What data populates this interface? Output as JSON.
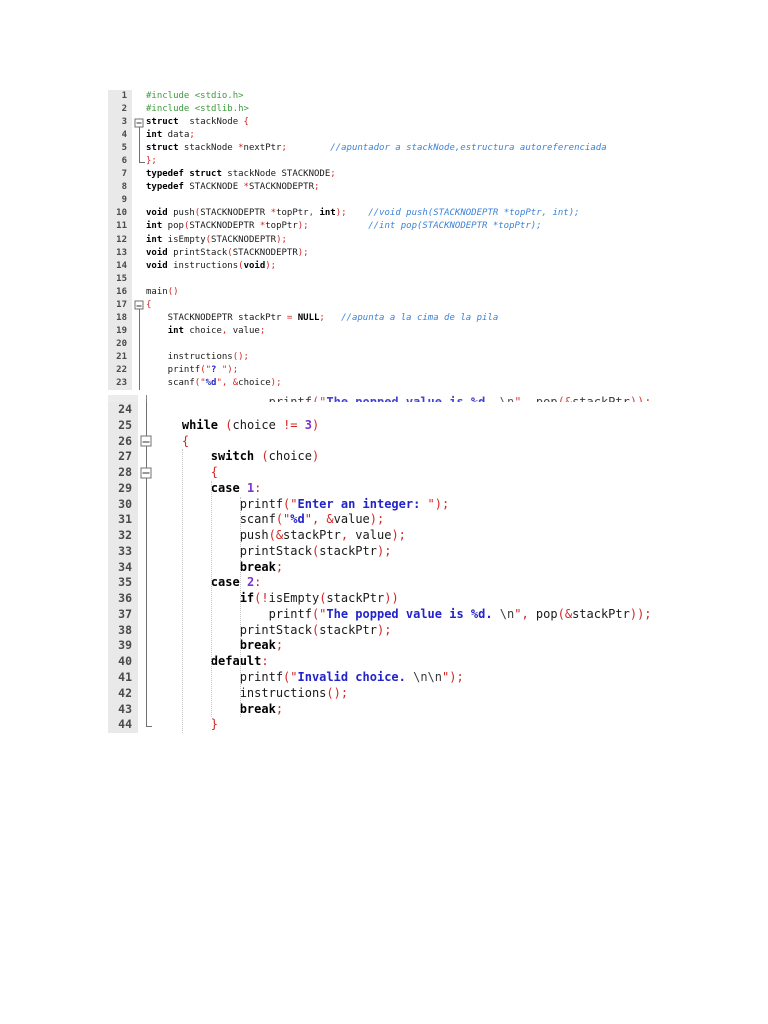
{
  "colors": {
    "gutterBg": "#e9e9e9",
    "lineNum": "#4a4a4a",
    "foldLine": "#707070",
    "punct": "#d22525",
    "preproc": "#3f9b3f",
    "comment": "#3b82d8",
    "string": "#2323cc",
    "escape": "#3a3a3a",
    "number": "#7d32cf",
    "keyword": "#000000",
    "plain": "#1a1a1a"
  },
  "blocks": [
    {
      "id": "block1",
      "lines": [
        {
          "n": 1,
          "fold": null,
          "t": [
            [
              "g",
              "#include <stdio.h>"
            ]
          ]
        },
        {
          "n": 2,
          "fold": null,
          "t": [
            [
              "g",
              "#include <stdlib.h>"
            ]
          ]
        },
        {
          "n": 3,
          "fold": "boxstart",
          "t": [
            [
              "k",
              "struct"
            ],
            [
              "n",
              "  stackNode "
            ],
            [
              "p",
              "{"
            ]
          ]
        },
        {
          "n": 4,
          "fold": "line",
          "t": [
            [
              "k",
              "int"
            ],
            [
              "n",
              " data"
            ],
            [
              "p",
              ";"
            ]
          ]
        },
        {
          "n": 5,
          "fold": "line",
          "t": [
            [
              "k",
              "struct"
            ],
            [
              "n",
              " stackNode "
            ],
            [
              "p",
              "*"
            ],
            [
              "n",
              "nextPtr"
            ],
            [
              "p",
              ";"
            ],
            [
              "n",
              "        "
            ],
            [
              "c",
              "//apuntador a stackNode,estructura autoreferenciada"
            ]
          ]
        },
        {
          "n": 6,
          "fold": "end",
          "t": [
            [
              "p",
              "};"
            ]
          ]
        },
        {
          "n": 7,
          "fold": null,
          "t": [
            [
              "k",
              "typedef"
            ],
            [
              "n",
              " "
            ],
            [
              "k",
              "struct"
            ],
            [
              "n",
              " stackNode STACKNODE"
            ],
            [
              "p",
              ";"
            ]
          ]
        },
        {
          "n": 8,
          "fold": null,
          "t": [
            [
              "k",
              "typedef"
            ],
            [
              "n",
              " STACKNODE "
            ],
            [
              "p",
              "*"
            ],
            [
              "n",
              "STACKNODEPTR"
            ],
            [
              "p",
              ";"
            ]
          ]
        },
        {
          "n": 9,
          "fold": null,
          "t": []
        },
        {
          "n": 10,
          "fold": null,
          "t": [
            [
              "k",
              "void"
            ],
            [
              "n",
              " push"
            ],
            [
              "p",
              "("
            ],
            [
              "n",
              "STACKNODEPTR "
            ],
            [
              "p",
              "*"
            ],
            [
              "n",
              "topPtr"
            ],
            [
              "p",
              ","
            ],
            [
              "n",
              " "
            ],
            [
              "k",
              "int"
            ],
            [
              "p",
              ");"
            ],
            [
              "n",
              "    "
            ],
            [
              "c",
              "//void push(STACKNODEPTR *topPtr, int);"
            ]
          ]
        },
        {
          "n": 11,
          "fold": null,
          "t": [
            [
              "k",
              "int"
            ],
            [
              "n",
              " pop"
            ],
            [
              "p",
              "("
            ],
            [
              "n",
              "STACKNODEPTR "
            ],
            [
              "p",
              "*"
            ],
            [
              "n",
              "topPtr"
            ],
            [
              "p",
              ");"
            ],
            [
              "n",
              "           "
            ],
            [
              "c",
              "//int pop(STACKNODEPTR *topPtr);"
            ]
          ]
        },
        {
          "n": 12,
          "fold": null,
          "t": [
            [
              "k",
              "int"
            ],
            [
              "n",
              " isEmpty"
            ],
            [
              "p",
              "("
            ],
            [
              "n",
              "STACKNODEPTR"
            ],
            [
              "p",
              ");"
            ]
          ]
        },
        {
          "n": 13,
          "fold": null,
          "t": [
            [
              "k",
              "void"
            ],
            [
              "n",
              " printStack"
            ],
            [
              "p",
              "("
            ],
            [
              "n",
              "STACKNODEPTR"
            ],
            [
              "p",
              ");"
            ]
          ]
        },
        {
          "n": 14,
          "fold": null,
          "t": [
            [
              "k",
              "void"
            ],
            [
              "n",
              " instructions"
            ],
            [
              "p",
              "("
            ],
            [
              "k",
              "void"
            ],
            [
              "p",
              ");"
            ]
          ]
        },
        {
          "n": 15,
          "fold": null,
          "t": []
        },
        {
          "n": 16,
          "fold": null,
          "t": [
            [
              "n",
              "main"
            ],
            [
              "p",
              "()"
            ]
          ]
        },
        {
          "n": 17,
          "fold": "boxstart",
          "t": [
            [
              "p",
              "{"
            ]
          ]
        },
        {
          "n": 18,
          "fold": "line",
          "t": [
            [
              "n",
              "    STACKNODEPTR stackPtr "
            ],
            [
              "p",
              "="
            ],
            [
              "n",
              " "
            ],
            [
              "k",
              "NULL"
            ],
            [
              "p",
              ";"
            ],
            [
              "n",
              "   "
            ],
            [
              "c",
              "//apunta a la cima de la pila"
            ]
          ]
        },
        {
          "n": 19,
          "fold": "line",
          "t": [
            [
              "n",
              "    "
            ],
            [
              "k",
              "int"
            ],
            [
              "n",
              " choice"
            ],
            [
              "p",
              ","
            ],
            [
              "n",
              " value"
            ],
            [
              "p",
              ";"
            ]
          ]
        },
        {
          "n": 20,
          "fold": "line",
          "t": []
        },
        {
          "n": 21,
          "fold": "line",
          "t": [
            [
              "n",
              "    instructions"
            ],
            [
              "p",
              "();"
            ]
          ]
        },
        {
          "n": 22,
          "fold": "line",
          "t": [
            [
              "n",
              "    printf"
            ],
            [
              "p",
              "(\""
            ],
            [
              "s",
              "? "
            ],
            [
              "p",
              "\");"
            ]
          ]
        },
        {
          "n": 23,
          "fold": "line",
          "t": [
            [
              "n",
              "    scanf"
            ],
            [
              "p",
              "(\""
            ],
            [
              "s",
              "%d"
            ],
            [
              "p",
              "\","
            ],
            [
              "n",
              " "
            ],
            [
              "p",
              "&"
            ],
            [
              "n",
              "choice"
            ],
            [
              "p",
              ");"
            ]
          ]
        }
      ]
    },
    {
      "id": "block2",
      "cut_line_top": {
        "fold": "line",
        "t": [
          [
            "n",
            "                printf"
          ],
          [
            "p",
            "(\""
          ],
          [
            "s",
            "The popped value is %d. "
          ],
          [
            "e",
            "\\n"
          ],
          [
            "p",
            "\","
          ],
          [
            "n",
            " pop"
          ],
          [
            "p",
            "(&"
          ],
          [
            "n",
            "stackPtr"
          ],
          [
            "p",
            "));"
          ]
        ]
      },
      "lines": [
        {
          "n": 24,
          "fold": "line",
          "t": []
        },
        {
          "n": 25,
          "fold": "line",
          "t": [
            [
              "n",
              "    "
            ],
            [
              "k",
              "while"
            ],
            [
              "n",
              " "
            ],
            [
              "p",
              "("
            ],
            [
              "n",
              "choice "
            ],
            [
              "p",
              "!="
            ],
            [
              "n",
              " "
            ],
            [
              "u",
              "3"
            ],
            [
              "p",
              ")"
            ]
          ]
        },
        {
          "n": 26,
          "fold": "boxmid",
          "t": [
            [
              "n",
              "    "
            ],
            [
              "p",
              "{"
            ]
          ]
        },
        {
          "n": 27,
          "fold": "line",
          "t": [
            [
              "n",
              "        "
            ],
            [
              "k",
              "switch"
            ],
            [
              "n",
              " "
            ],
            [
              "p",
              "("
            ],
            [
              "n",
              "choice"
            ],
            [
              "p",
              ")"
            ]
          ]
        },
        {
          "n": 28,
          "fold": "boxmid",
          "t": [
            [
              "n",
              "        "
            ],
            [
              "p",
              "{"
            ]
          ]
        },
        {
          "n": 29,
          "fold": "line",
          "t": [
            [
              "n",
              "        "
            ],
            [
              "k",
              "case"
            ],
            [
              "n",
              " "
            ],
            [
              "u",
              "1"
            ],
            [
              "p",
              ":"
            ]
          ]
        },
        {
          "n": 30,
          "fold": "line",
          "t": [
            [
              "n",
              "            printf"
            ],
            [
              "p",
              "(\""
            ],
            [
              "s",
              "Enter an integer: "
            ],
            [
              "p",
              "\");"
            ]
          ]
        },
        {
          "n": 31,
          "fold": "line",
          "t": [
            [
              "n",
              "            scanf"
            ],
            [
              "p",
              "(\""
            ],
            [
              "s",
              "%d"
            ],
            [
              "p",
              "\","
            ],
            [
              "n",
              " "
            ],
            [
              "p",
              "&"
            ],
            [
              "n",
              "value"
            ],
            [
              "p",
              ");"
            ]
          ]
        },
        {
          "n": 32,
          "fold": "line",
          "t": [
            [
              "n",
              "            push"
            ],
            [
              "p",
              "(&"
            ],
            [
              "n",
              "stackPtr"
            ],
            [
              "p",
              ","
            ],
            [
              "n",
              " value"
            ],
            [
              "p",
              ");"
            ]
          ]
        },
        {
          "n": 33,
          "fold": "line",
          "t": [
            [
              "n",
              "            printStack"
            ],
            [
              "p",
              "("
            ],
            [
              "n",
              "stackPtr"
            ],
            [
              "p",
              ");"
            ]
          ]
        },
        {
          "n": 34,
          "fold": "line",
          "t": [
            [
              "n",
              "            "
            ],
            [
              "k",
              "break"
            ],
            [
              "p",
              ";"
            ]
          ]
        },
        {
          "n": 35,
          "fold": "line",
          "t": [
            [
              "n",
              "        "
            ],
            [
              "k",
              "case"
            ],
            [
              "n",
              " "
            ],
            [
              "u",
              "2"
            ],
            [
              "p",
              ":"
            ]
          ]
        },
        {
          "n": 36,
          "fold": "line",
          "t": [
            [
              "n",
              "            "
            ],
            [
              "k",
              "if"
            ],
            [
              "p",
              "(!"
            ],
            [
              "n",
              "isEmpty"
            ],
            [
              "p",
              "("
            ],
            [
              "n",
              "stackPtr"
            ],
            [
              "p",
              "))"
            ]
          ]
        },
        {
          "n": 37,
          "fold": "line",
          "t": [
            [
              "n",
              "                printf"
            ],
            [
              "p",
              "(\""
            ],
            [
              "s",
              "The popped value is %d. "
            ],
            [
              "e",
              "\\n"
            ],
            [
              "p",
              "\","
            ],
            [
              "n",
              " pop"
            ],
            [
              "p",
              "(&"
            ],
            [
              "n",
              "stackPtr"
            ],
            [
              "p",
              "));"
            ]
          ]
        },
        {
          "n": 38,
          "fold": "line",
          "t": [
            [
              "n",
              "            printStack"
            ],
            [
              "p",
              "("
            ],
            [
              "n",
              "stackPtr"
            ],
            [
              "p",
              ");"
            ]
          ]
        },
        {
          "n": 39,
          "fold": "line",
          "t": [
            [
              "n",
              "            "
            ],
            [
              "k",
              "break"
            ],
            [
              "p",
              ";"
            ]
          ]
        },
        {
          "n": 40,
          "fold": "line",
          "t": [
            [
              "n",
              "        "
            ],
            [
              "k",
              "default"
            ],
            [
              "p",
              ":"
            ]
          ]
        },
        {
          "n": 41,
          "fold": "line",
          "t": [
            [
              "n",
              "            printf"
            ],
            [
              "p",
              "(\""
            ],
            [
              "s",
              "Invalid choice. "
            ],
            [
              "e",
              "\\n\\n"
            ],
            [
              "p",
              "\");"
            ]
          ]
        },
        {
          "n": 42,
          "fold": "line",
          "t": [
            [
              "n",
              "            instructions"
            ],
            [
              "p",
              "();"
            ]
          ]
        },
        {
          "n": 43,
          "fold": "line",
          "t": [
            [
              "n",
              "            "
            ],
            [
              "k",
              "break"
            ],
            [
              "p",
              ";"
            ]
          ]
        },
        {
          "n": 44,
          "fold": "end",
          "t": [
            [
              "n",
              "        "
            ],
            [
              "p",
              "}"
            ]
          ]
        }
      ]
    }
  ]
}
